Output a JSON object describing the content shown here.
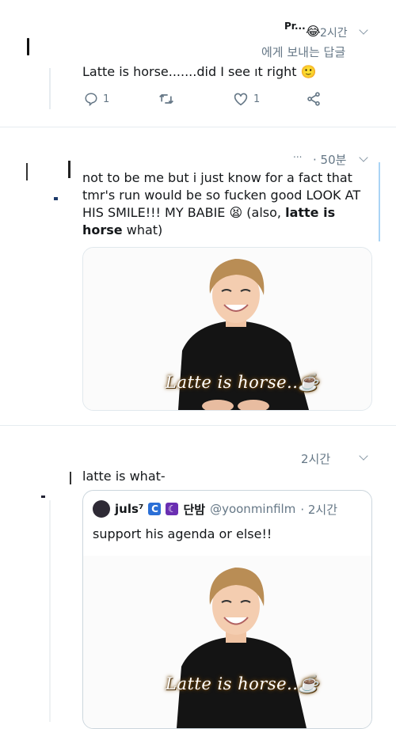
{
  "tweet1": {
    "author_partial": "Pr...",
    "emoji": "😂",
    "time": "2시간",
    "reply_to": "에게 보내는 답글",
    "text": "Latte is horse.......did I see ıt right",
    "emoji_end": "🙂",
    "actions": {
      "reply_count": "1",
      "retweet_count": "",
      "like_count": "1"
    }
  },
  "tweet2": {
    "time": "· 50분",
    "dots": "...",
    "text_line1": "not to be me but i just know for a fact that",
    "text_line2": "tmr's run would be so fucken good LOOK AT",
    "text_line3a": "HIS SMILE!!! MY BABIE",
    "text_line3_emoji": "😫",
    "text_line3b": "(also,",
    "text_line3_bold": "latte is",
    "text_line4_bold": "horse",
    "text_line4b": "what)",
    "media_caption": "Latte is horse..☕"
  },
  "tweet3": {
    "time": "2시간",
    "text": "latte is what-",
    "quote": {
      "author_name": "juls⁷",
      "badge1": "C",
      "badge2": "☾",
      "author_kr": "단밤",
      "handle": "@yoonminfilm",
      "time": "· 2시간",
      "text": "support his agenda or else!!",
      "media_caption": "Latte is horse..☕"
    }
  },
  "colors": {
    "text": "#14171a",
    "meta": "#657786",
    "accent": "#1da1f2"
  }
}
